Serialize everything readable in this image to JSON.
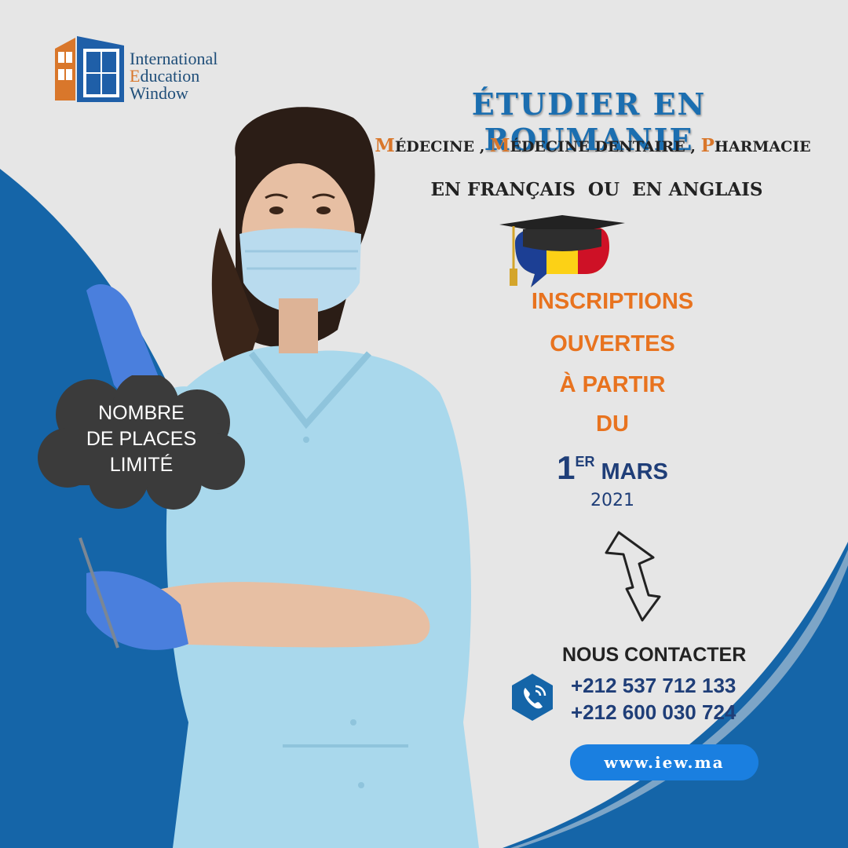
{
  "logo": {
    "line1": "International",
    "line2_cap": "E",
    "line2_rest": "ducation",
    "line3": "Window"
  },
  "headline": "ÉTUDIER EN ROUMANIE",
  "specialties": [
    {
      "initial": "M",
      "rest": "ÉDECINE"
    },
    {
      "initial": "M",
      "rest": "ÉDECINE DENTAIRE"
    },
    {
      "initial": "P",
      "rest": "HARMACIE"
    }
  ],
  "separator": " , ",
  "languages": "EN FRANÇAIS  OU  EN ANGLAIS",
  "inscriptions": {
    "line1": "INSCRIPTIONS",
    "line2": "OUVERTES",
    "line3": "À PARTIR",
    "line4": "DU",
    "day": "1",
    "ordinal": "ER",
    "month": "MARS",
    "year": "2021"
  },
  "cloud": {
    "line1": "NOMBRE",
    "line2": "DE PLACES",
    "line3": "LIMITÉ"
  },
  "contact": {
    "title": "NOUS CONTACTER",
    "phone1": "+212 537 712 133",
    "phone2": "+212 600 030 724",
    "website": "www.iew.ma"
  },
  "colors": {
    "blue": "#1565a8",
    "orange": "#e8731f",
    "navy": "#1f3e78",
    "web_button": "#1a7fe0"
  }
}
